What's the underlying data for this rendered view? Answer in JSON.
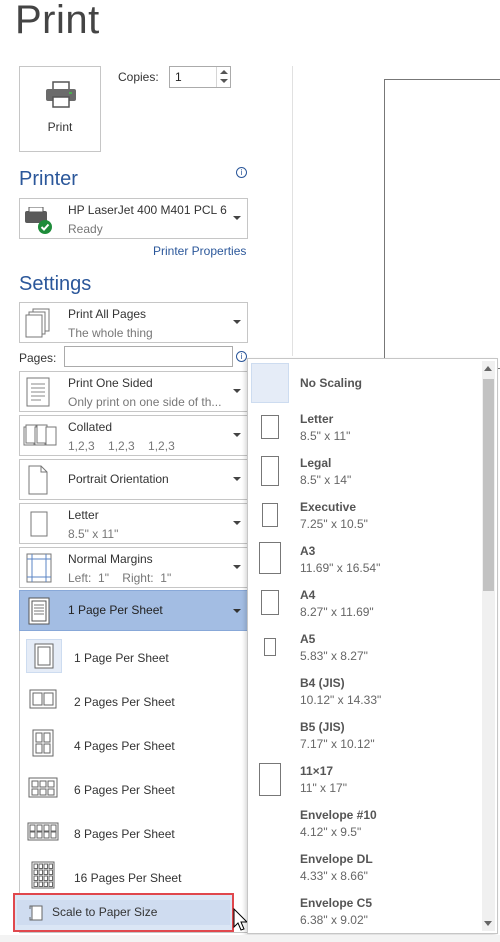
{
  "page_title": "Print",
  "print_button": {
    "label": "Print",
    "icon": "printer-icon"
  },
  "copies": {
    "label": "Copies:",
    "value": "1"
  },
  "printer": {
    "heading": "Printer",
    "name": "HP LaserJet 400 M401 PCL 6",
    "status": "Ready",
    "properties_link": "Printer Properties",
    "info_glyph": "i"
  },
  "settings": {
    "heading": "Settings",
    "pages_label": "Pages:",
    "pages_value": "",
    "items": [
      {
        "line1": "Print All Pages",
        "line2": "The whole thing"
      },
      {
        "line1": "Print One Sided",
        "line2": "Only print on one side of th..."
      },
      {
        "line1": "Collated",
        "line2": "1,2,3    1,2,3    1,2,3"
      },
      {
        "line1": "Portrait Orientation",
        "line2": ""
      },
      {
        "line1": "Letter",
        "line2": "8.5\" x 11\""
      },
      {
        "line1": "Normal Margins",
        "line2": "Left:  1\"    Right:  1\""
      }
    ]
  },
  "pages_per_sheet": {
    "selected": "1 Page Per Sheet",
    "options": [
      {
        "label": "1 Page Per Sheet"
      },
      {
        "label": "2 Pages Per Sheet"
      },
      {
        "label": "4 Pages Per Sheet"
      },
      {
        "label": "6 Pages Per Sheet"
      },
      {
        "label": "8 Pages Per Sheet"
      },
      {
        "label": "16 Pages Per Sheet"
      }
    ],
    "scale_option": "Scale to Paper Size"
  },
  "scaling_list": [
    {
      "name": "No Scaling",
      "dim": ""
    },
    {
      "name": "Letter",
      "dim": "8.5\" x 11\""
    },
    {
      "name": "Legal",
      "dim": "8.5\" x 14\""
    },
    {
      "name": "Executive",
      "dim": "7.25\" x 10.5\""
    },
    {
      "name": "A3",
      "dim": "11.69\" x 16.54\""
    },
    {
      "name": "A4",
      "dim": "8.27\" x 11.69\""
    },
    {
      "name": "A5",
      "dim": "5.83\" x 8.27\""
    },
    {
      "name": "B4 (JIS)",
      "dim": "10.12\" x 14.33\""
    },
    {
      "name": "B5 (JIS)",
      "dim": "7.17\" x 10.12\""
    },
    {
      "name": "11×17",
      "dim": "11\" x 17\""
    },
    {
      "name": "Envelope #10",
      "dim": "4.12\" x 9.5\""
    },
    {
      "name": "Envelope DL",
      "dim": "4.33\" x 8.66\""
    },
    {
      "name": "Envelope C5",
      "dim": "6.38\" x 9.02\""
    }
  ],
  "colors": {
    "accent": "#2b579a",
    "selected_bg": "#a3bde3",
    "highlight_border": "#e0484d"
  }
}
